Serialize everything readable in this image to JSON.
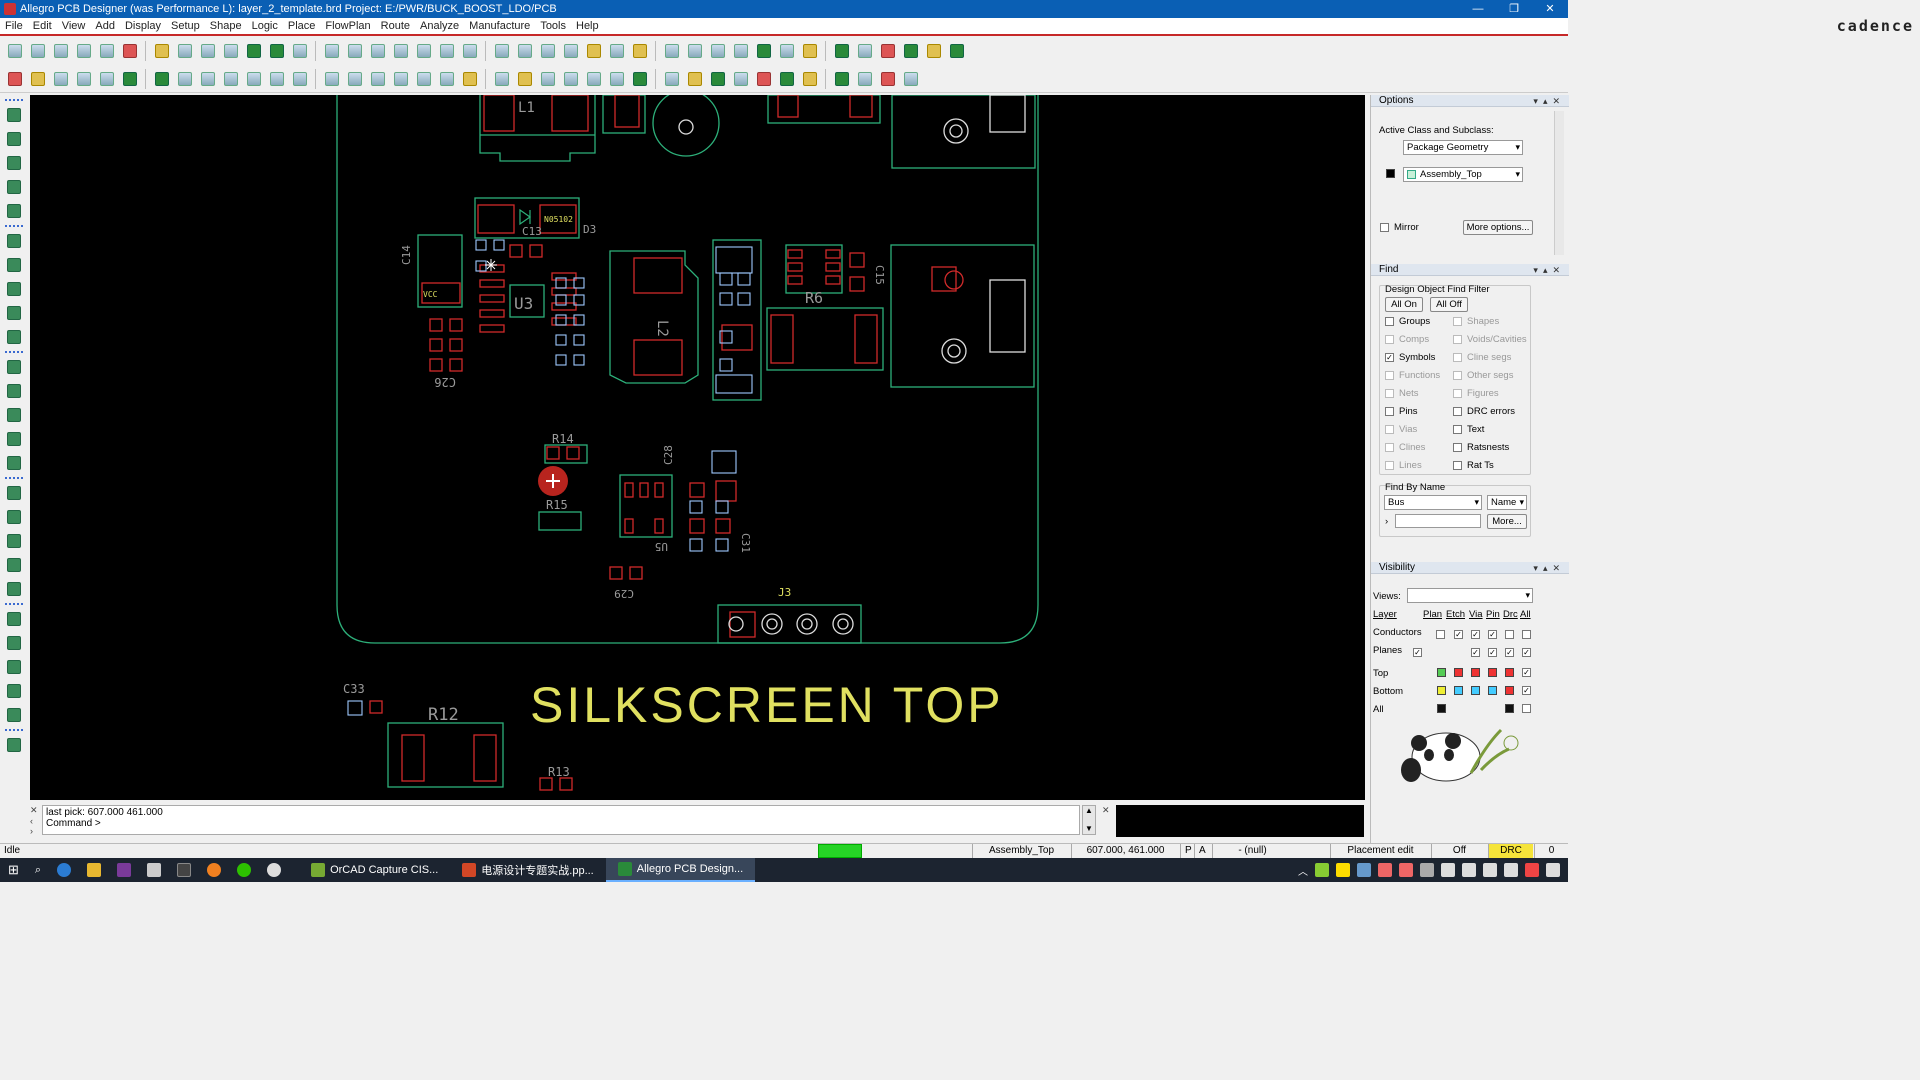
{
  "window": {
    "title": "Allegro PCB Designer (was Performance L): layer_2_template.brd  Project: E:/PWR/BUCK_BOOST_LDO/PCB",
    "min": "—",
    "max": "❐",
    "close": "✕"
  },
  "menu": [
    "File",
    "Edit",
    "View",
    "Add",
    "Display",
    "Setup",
    "Shape",
    "Logic",
    "Place",
    "FlowPlan",
    "Route",
    "Analyze",
    "Manufacture",
    "Tools",
    "Help"
  ],
  "brand": "cadence",
  "canvas": {
    "silkscreen_text": "SILKSCREEN TOP",
    "refdes": {
      "L1": "L1",
      "D3": "D3",
      "C13": "C13",
      "C14": "C14",
      "U3": "U3",
      "L2": "L2",
      "R6": "R6",
      "C15": "C15",
      "C26": "C26",
      "R14": "R14",
      "R15": "R15",
      "C28": "C28",
      "U5": "U5",
      "C31": "C31",
      "C29": "C29",
      "J3": "J3",
      "C33": "C33",
      "R12": "R12",
      "R13": "R13",
      "VCC": "VCC",
      "N05102": "N05102"
    },
    "colors": {
      "bg": "#000000",
      "outline": "#2db07a",
      "pad": "#d02a2a",
      "silk": "#e0e060",
      "label": "#9a9a9a"
    }
  },
  "command": {
    "line1": "last pick:  607.000 461.000",
    "line2": "Command >"
  },
  "options": {
    "header": "Options",
    "active_class_label": "Active Class and Subclass:",
    "class_value": "Package Geometry",
    "subclass_value": "Assembly_Top",
    "mirror_label": "Mirror",
    "more_options": "More options..."
  },
  "find": {
    "header": "Find",
    "group_title": "Design Object Find Filter",
    "all_on": "All On",
    "all_off": "All Off",
    "left": [
      {
        "label": "Groups",
        "checked": false,
        "enabled": true
      },
      {
        "label": "Comps",
        "checked": false,
        "enabled": false
      },
      {
        "label": "Symbols",
        "checked": true,
        "enabled": true
      },
      {
        "label": "Functions",
        "checked": false,
        "enabled": false
      },
      {
        "label": "Nets",
        "checked": false,
        "enabled": false
      },
      {
        "label": "Pins",
        "checked": false,
        "enabled": true
      },
      {
        "label": "Vias",
        "checked": false,
        "enabled": false
      },
      {
        "label": "Clines",
        "checked": false,
        "enabled": false
      },
      {
        "label": "Lines",
        "checked": false,
        "enabled": false
      }
    ],
    "right": [
      {
        "label": "Shapes",
        "checked": false,
        "enabled": false
      },
      {
        "label": "Voids/Cavities",
        "checked": false,
        "enabled": false
      },
      {
        "label": "Cline segs",
        "checked": false,
        "enabled": false
      },
      {
        "label": "Other segs",
        "checked": false,
        "enabled": false
      },
      {
        "label": "Figures",
        "checked": false,
        "enabled": false
      },
      {
        "label": "DRC errors",
        "checked": false,
        "enabled": true
      },
      {
        "label": "Text",
        "checked": false,
        "enabled": true
      },
      {
        "label": "Ratsnests",
        "checked": false,
        "enabled": true
      },
      {
        "label": "Rat Ts",
        "checked": false,
        "enabled": true
      }
    ],
    "find_by_name": "Find By Name",
    "name_type": "Bus",
    "name_mode": "Name",
    "more": "More..."
  },
  "visibility": {
    "header": "Visibility",
    "views_label": "Views:",
    "layer_label": "Layer",
    "cols": [
      "Plan",
      "Etch",
      "Via",
      "Pin",
      "Drc",
      "All"
    ],
    "conductors": "Conductors",
    "planes": "Planes",
    "top": "Top",
    "bottom": "Bottom",
    "all": "All"
  },
  "status": {
    "state": "Idle",
    "subclass": "Assembly_Top",
    "coords": "607.000, 461.000",
    "p": "P",
    "a": "A",
    "null": "- (null)",
    "mode": "Placement edit",
    "off": "Off",
    "drc": "DRC",
    "count": "0"
  },
  "taskbar": [
    {
      "label": "OrCAD Capture CIS...",
      "color": "#7a3",
      "active": false
    },
    {
      "label": "电源设计专题实战.pp...",
      "color": "#d24726",
      "active": false
    },
    {
      "label": "Allegro PCB Design...",
      "color": "#2a8a3a",
      "active": true
    }
  ]
}
